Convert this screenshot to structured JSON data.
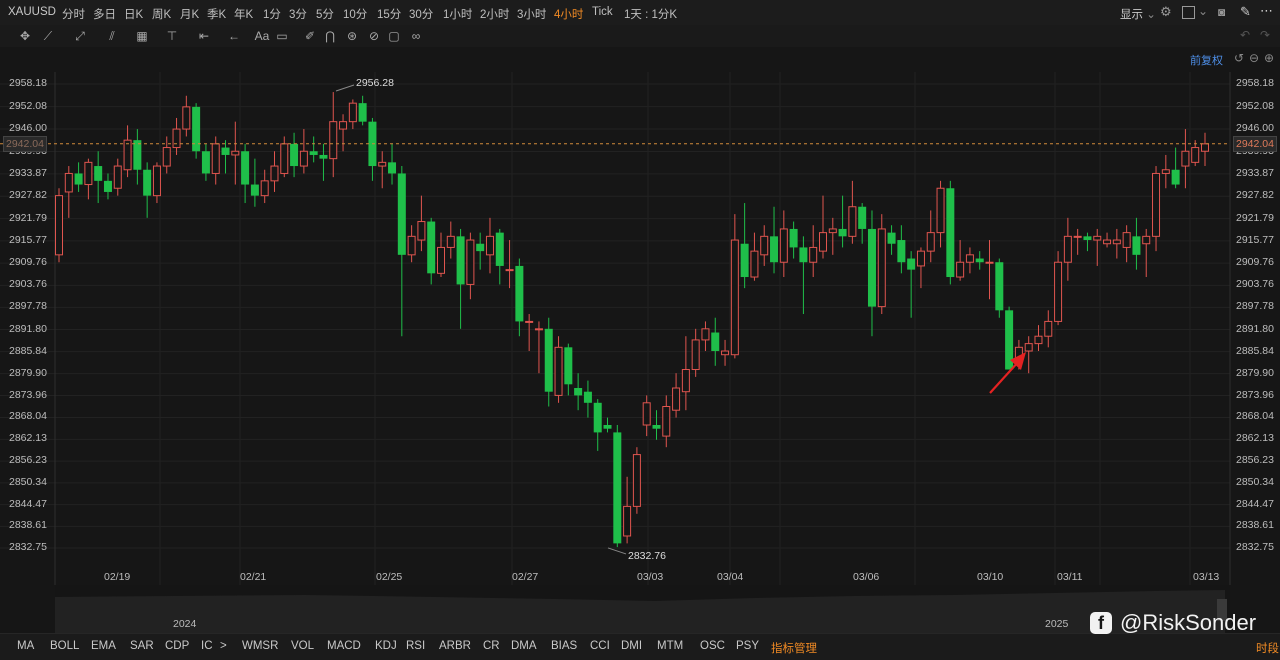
{
  "header": {
    "symbol": "XAUUSD",
    "periods": [
      "分时",
      "多日",
      "日K",
      "周K",
      "月K",
      "季K",
      "年K",
      "1分",
      "3分",
      "5分",
      "10分",
      "15分",
      "30分",
      "1小时",
      "2小时",
      "3小时",
      "4小时",
      "Tick",
      "1天 : 1分K"
    ],
    "active_period": "4小时",
    "display_label": "显示",
    "restore_label": "前复权"
  },
  "toolbar": {
    "icons": [
      "move-icon",
      "line-tool-icon",
      "ray-tool-icon",
      "channel-tool-icon",
      "fib-tool-icon",
      "pattern-tool-icon",
      "measure-tool-icon",
      "arrow-tool-icon",
      "text-tool-icon",
      "note-tool-icon",
      "pen-tool-icon",
      "magnet-icon",
      "lock-icon",
      "hide-icon",
      "trash-icon",
      "link-icon",
      "settings-icon"
    ],
    "text_tool_label": "Aa"
  },
  "colors": {
    "up": "#e0554f",
    "down": "#1fbf4a",
    "background": "#161616",
    "current_price_line": "#d08a3a",
    "active": "#f08a24",
    "arrow": "#e52222"
  },
  "current_price": {
    "label": "2942.04"
  },
  "chart_data": {
    "type": "candlestick",
    "y_axis": {
      "ticks": [
        "2958.18",
        "2952.08",
        "2946.00",
        "2939.93",
        "2933.87",
        "2927.82",
        "2921.79",
        "2915.77",
        "2909.76",
        "2903.76",
        "2897.78",
        "2891.80",
        "2885.84",
        "2879.90",
        "2873.96",
        "2868.04",
        "2862.13",
        "2856.23",
        "2850.34",
        "2844.47",
        "2838.61",
        "2832.75"
      ],
      "range": [
        2830,
        2960
      ]
    },
    "x_axis": {
      "ticks": [
        "02/19",
        "02/21",
        "02/25",
        "02/27",
        "03/03",
        "03/04",
        "03/06",
        "03/10",
        "03/11",
        "03/13"
      ]
    },
    "annotations": {
      "high": "2956.28",
      "low": "2832.76"
    },
    "candles": [
      [
        2912,
        2928,
        2910,
        2930
      ],
      [
        2929,
        2934,
        2922,
        2936
      ],
      [
        2934,
        2931,
        2929,
        2937
      ],
      [
        2931,
        2937,
        2927,
        2938
      ],
      [
        2936,
        2932,
        2926,
        2940
      ],
      [
        2932,
        2929,
        2927,
        2934
      ],
      [
        2930,
        2936,
        2928,
        2938
      ],
      [
        2935,
        2943,
        2933,
        2947
      ],
      [
        2943,
        2935,
        2931,
        2946
      ],
      [
        2935,
        2928,
        2922,
        2937
      ],
      [
        2928,
        2936,
        2926,
        2937
      ],
      [
        2936,
        2941,
        2934,
        2944
      ],
      [
        2941,
        2946,
        2939,
        2949
      ],
      [
        2946,
        2952,
        2944,
        2955
      ],
      [
        2952,
        2940,
        2938,
        2953
      ],
      [
        2940,
        2934,
        2932,
        2942
      ],
      [
        2934,
        2942,
        2931,
        2944
      ],
      [
        2941,
        2939,
        2934,
        2943
      ],
      [
        2939,
        2940,
        2931,
        2948
      ],
      [
        2940,
        2931,
        2926,
        2942
      ],
      [
        2931,
        2928,
        2925,
        2938
      ],
      [
        2928,
        2932,
        2926,
        2935
      ],
      [
        2932,
        2936,
        2929,
        2940
      ],
      [
        2934,
        2942,
        2933,
        2944
      ],
      [
        2942,
        2936,
        2933,
        2945
      ],
      [
        2936,
        2940,
        2934,
        2946
      ],
      [
        2940,
        2939,
        2937,
        2944
      ],
      [
        2939,
        2938,
        2932,
        2942
      ],
      [
        2938,
        2948,
        2933,
        2956
      ],
      [
        2946,
        2948,
        2940,
        2950
      ],
      [
        2948,
        2953,
        2946,
        2954
      ],
      [
        2953,
        2948,
        2947,
        2955
      ],
      [
        2948,
        2936,
        2932,
        2949
      ],
      [
        2936,
        2937,
        2930,
        2940
      ],
      [
        2937,
        2934,
        2931,
        2942
      ],
      [
        2934,
        2912,
        2890,
        2936
      ],
      [
        2912,
        2917,
        2910,
        2920
      ],
      [
        2916,
        2921,
        2913,
        2928
      ],
      [
        2921,
        2907,
        2904,
        2922
      ],
      [
        2907,
        2914,
        2906,
        2918
      ],
      [
        2914,
        2917,
        2911,
        2921
      ],
      [
        2917,
        2904,
        2892,
        2919
      ],
      [
        2904,
        2916,
        2900,
        2918
      ],
      [
        2915,
        2913,
        2908,
        2918
      ],
      [
        2912,
        2917,
        2907,
        2922
      ],
      [
        2918,
        2909,
        2904,
        2919
      ],
      [
        2908,
        2908,
        2903,
        2916
      ],
      [
        2909,
        2894,
        2890,
        2911
      ],
      [
        2894,
        2894,
        2886,
        2896
      ],
      [
        2892,
        2892,
        2880,
        2894
      ],
      [
        2892,
        2875,
        2871,
        2895
      ],
      [
        2874,
        2887,
        2872,
        2890
      ],
      [
        2887,
        2877,
        2874,
        2888
      ],
      [
        2876,
        2874,
        2870,
        2880
      ],
      [
        2875,
        2872,
        2868,
        2878
      ],
      [
        2872,
        2864,
        2859,
        2873
      ],
      [
        2866,
        2865,
        2864,
        2868
      ],
      [
        2864,
        2834,
        2833,
        2866
      ],
      [
        2836,
        2844,
        2834,
        2852
      ],
      [
        2844,
        2858,
        2842,
        2860
      ],
      [
        2866,
        2872,
        2863,
        2874
      ],
      [
        2866,
        2865,
        2862,
        2870
      ],
      [
        2863,
        2871,
        2860,
        2874
      ],
      [
        2870,
        2876,
        2868,
        2880
      ],
      [
        2875,
        2881,
        2870,
        2890
      ],
      [
        2881,
        2889,
        2879,
        2892
      ],
      [
        2889,
        2892,
        2886,
        2894
      ],
      [
        2891,
        2886,
        2882,
        2895
      ],
      [
        2885,
        2886,
        2882,
        2889
      ],
      [
        2885,
        2916,
        2884,
        2923
      ],
      [
        2915,
        2906,
        2903,
        2926
      ],
      [
        2906,
        2913,
        2905,
        2918
      ],
      [
        2912,
        2917,
        2909,
        2920
      ],
      [
        2917,
        2910,
        2907,
        2925
      ],
      [
        2910,
        2919,
        2906,
        2924
      ],
      [
        2919,
        2914,
        2911,
        2921
      ],
      [
        2914,
        2910,
        2896,
        2917
      ],
      [
        2910,
        2914,
        2906,
        2920
      ],
      [
        2913,
        2918,
        2911,
        2928
      ],
      [
        2918,
        2919,
        2912,
        2922
      ],
      [
        2919,
        2917,
        2914,
        2928
      ],
      [
        2917,
        2925,
        2915,
        2932
      ],
      [
        2925,
        2919,
        2915,
        2926
      ],
      [
        2919,
        2898,
        2890,
        2924
      ],
      [
        2898,
        2919,
        2896,
        2923
      ],
      [
        2918,
        2915,
        2912,
        2920
      ],
      [
        2916,
        2910,
        2907,
        2920
      ],
      [
        2911,
        2908,
        2895,
        2913
      ],
      [
        2909,
        2913,
        2903,
        2914
      ],
      [
        2913,
        2918,
        2910,
        2924
      ],
      [
        2918,
        2930,
        2914,
        2932
      ],
      [
        2930,
        2906,
        2904,
        2932
      ],
      [
        2906,
        2910,
        2905,
        2916
      ],
      [
        2910,
        2912,
        2907,
        2914
      ],
      [
        2911,
        2910,
        2908,
        2913
      ],
      [
        2910,
        2910,
        2900,
        2916
      ],
      [
        2910,
        2897,
        2895,
        2911
      ],
      [
        2897,
        2881,
        2881,
        2898
      ],
      [
        2884,
        2887,
        2881,
        2889
      ],
      [
        2886,
        2888,
        2880,
        2890
      ],
      [
        2888,
        2890,
        2886,
        2893
      ],
      [
        2890,
        2894,
        2887,
        2897
      ],
      [
        2894,
        2910,
        2893,
        2913
      ],
      [
        2910,
        2917,
        2905,
        2922
      ],
      [
        2917,
        2917,
        2912,
        2919
      ],
      [
        2917,
        2916,
        2913,
        2918
      ],
      [
        2916,
        2917,
        2909,
        2919
      ],
      [
        2915,
        2916,
        2914,
        2918
      ],
      [
        2915,
        2916,
        2911,
        2919
      ],
      [
        2914,
        2918,
        2910,
        2920
      ],
      [
        2917,
        2912,
        2908,
        2922
      ],
      [
        2915,
        2917,
        2906,
        2919
      ],
      [
        2917,
        2934,
        2913,
        2936
      ],
      [
        2934,
        2935,
        2930,
        2939
      ],
      [
        2935,
        2931,
        2930,
        2941
      ],
      [
        2936,
        2940,
        2930,
        2946
      ],
      [
        2937,
        2941,
        2936,
        2943
      ],
      [
        2940,
        2942,
        2936,
        2945
      ]
    ]
  },
  "navigator": {
    "year_left": "2024",
    "year_right": "2025"
  },
  "indicators": [
    "MA",
    "BOLL",
    "EMA",
    "SAR",
    "CDP",
    "IC",
    "WMSR",
    "VOL",
    "MACD",
    "KDJ",
    "RSI",
    "ARBR",
    "CR",
    "DMA",
    "BIAS",
    "CCI",
    "DMI",
    "MTM",
    "OSC",
    "PSY"
  ],
  "indicator_manager_label": "指标管理",
  "time_segment_label": "时段",
  "watermark": "@RiskSonder"
}
